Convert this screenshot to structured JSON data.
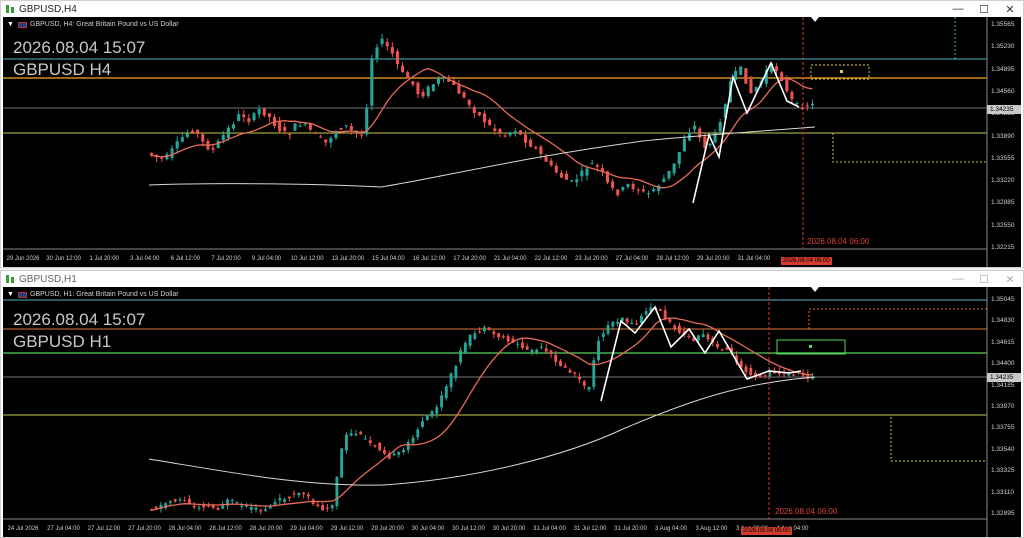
{
  "colors": {
    "background": "#000000",
    "bull": "#26a69a",
    "bear": "#ef5350",
    "ma_fast": "#e86a5a",
    "ma_slow": "#d8d8d8",
    "level_orange": "#f5a623",
    "level_olive": "#c8c84a",
    "level_green": "#53d35a",
    "level_teal": "#4fb6c2",
    "level_gray": "#9a9a9a",
    "vline": "#d03a2d",
    "zigzag": "#ffffff"
  },
  "windows": [
    {
      "title": "GBPUSD,H4",
      "symbol_header": "GBPUSD, H4:  Great Britain Pound vs US Dollar",
      "overlay_datetime": "2026.08.04 15:07",
      "overlay_symbol": "GBPUSD H4",
      "price_labels": [
        "1.35565",
        "1.35230",
        "1.34895",
        "1.34560",
        "1.34235",
        "1.33890",
        "1.33555",
        "1.33220",
        "1.32885",
        "1.32550",
        "1.32215"
      ],
      "current_price": "1.34235",
      "time_labels": [
        "29 Jun 2026",
        "30 Jun 12:00",
        "1 Jul 20:00",
        "3 Jul 04:00",
        "6 Jul 12:00",
        "7 Jul 20:00",
        "9 Jul 04:00",
        "10 Jul 12:00",
        "13 Jul 20:00",
        "15 Jul 04:00",
        "16 Jul 12:00",
        "17 Jul 20:00",
        "21 Jul 04:00",
        "22 Jul 12:00",
        "23 Jul 20:00",
        "27 Jul 04:00",
        "28 Jul 12:00",
        "29 Jul 20:00",
        "31 Jul 04:00"
      ],
      "current_time_label": "2026.08.04 06:00",
      "vline_label": "2026.08.04 06:00",
      "controls": {
        "minimize": "—",
        "maximize": "☐",
        "close": "✕"
      }
    },
    {
      "title": "GBPUSD,H1",
      "symbol_header": "GBPUSD, H1:  Great Britain Pound vs US Dollar",
      "overlay_datetime": "2026.08.04 15:07",
      "overlay_symbol": "GBPUSD H1",
      "price_labels": [
        "1.35045",
        "1.34830",
        "1.34615",
        "1.34400",
        "1.34185",
        "1.33970",
        "1.33755",
        "1.33540",
        "1.33325",
        "1.33110",
        "1.32895"
      ],
      "current_price": "1.34235",
      "time_labels": [
        "24 Jul 2026",
        "27 Jul 04:00",
        "27 Jul 12:00",
        "27 Jul 20:00",
        "28 Jul 04:00",
        "28 Jul 12:00",
        "28 Jul 20:00",
        "29 Jul 04:00",
        "29 Jul 12:00",
        "29 Jul 20:00",
        "30 Jul 04:00",
        "30 Jul 12:00",
        "30 Jul 20:00",
        "31 Jul 04:00",
        "31 Jul 12:00",
        "31 Jul 20:00",
        "3 Aug 04:00",
        "3 Aug 12:00",
        "3 Aug 20:00",
        "4 Aug 04:00"
      ],
      "current_time_label": "2026.08.04 06:00",
      "vline_label": "2026.08.04 06:00",
      "controls": {
        "minimize": "—",
        "maximize": "☐",
        "close": "✕"
      }
    }
  ]
}
